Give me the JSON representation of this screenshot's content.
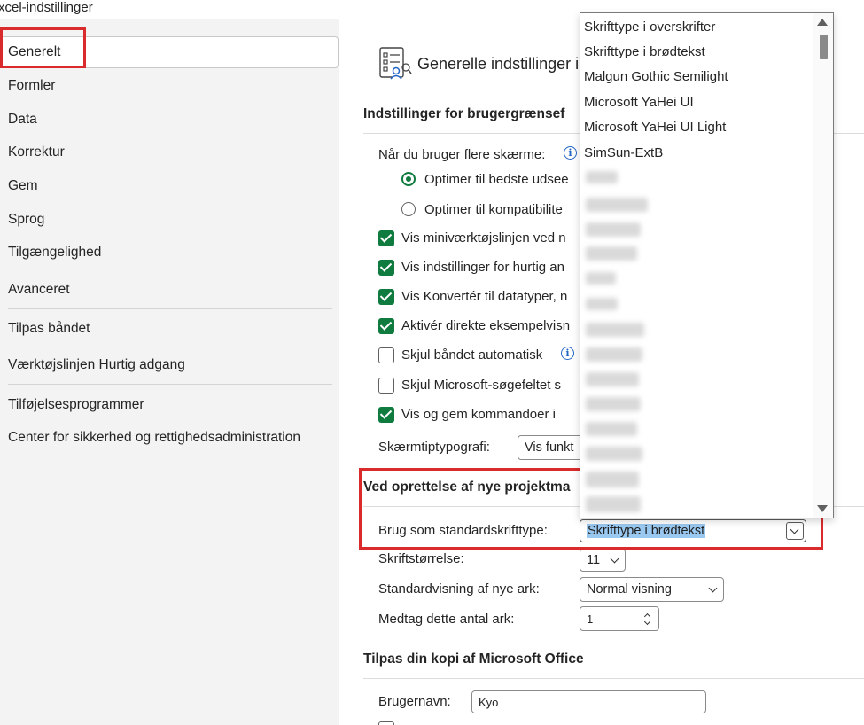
{
  "window": {
    "title": "xcel-indstillinger"
  },
  "sidebar": {
    "items": [
      {
        "label": "Generelt",
        "selected": true
      },
      {
        "label": "Formler"
      },
      {
        "label": "Data"
      },
      {
        "label": "Korrektur"
      },
      {
        "label": "Gem"
      },
      {
        "label": "Sprog"
      },
      {
        "label": "Tilgængelighed"
      },
      {
        "label": "Avanceret"
      },
      {
        "label": "Tilpas båndet"
      },
      {
        "label": "Værktøjslinjen Hurtig adgang"
      },
      {
        "label": "Tilføjelsesprogrammer"
      },
      {
        "label": "Center for sikkerhed og rettighedsadministration"
      }
    ]
  },
  "main": {
    "heading": "Generelle indstillinger i",
    "ui_section": {
      "title": "Indstillinger for brugergrænsef",
      "multi_screen_label": "Når du bruger flere skærme:",
      "radio_best": "Optimer til bedste udsee",
      "radio_compat": "Optimer til kompatibilite",
      "options": [
        {
          "label": "Vis miniværktøjslinjen ved n",
          "checked": true
        },
        {
          "label": "Vis indstillinger for hurtig an",
          "checked": true
        },
        {
          "label": "Vis Konvertér til datatyper, n",
          "checked": true
        },
        {
          "label": "Aktivér direkte eksempelvisn",
          "checked": true
        },
        {
          "label": "Skjul båndet automatisk",
          "checked": false
        },
        {
          "label": "Skjul Microsoft-søgefeltet s",
          "checked": false
        },
        {
          "label": "Vis og gem kommandoer i",
          "checked": true
        }
      ],
      "tooltip_label": "Skærmtiptypografi:",
      "tooltip_value": "Vis funkt"
    },
    "new_workbook": {
      "title": "Ved oprettelse af nye projektma",
      "font_label": "Brug som standardskrifttype:",
      "font_value": "Skrifttype i brødtekst",
      "size_label": "Skriftstørrelse:",
      "size_value": "11",
      "view_label": "Standardvisning af nye ark:",
      "view_value": "Normal visning",
      "sheets_label": "Medtag dette antal ark:",
      "sheets_value": "1"
    },
    "personalize": {
      "title": "Tilpas din kopi af Microsoft Office",
      "username_label": "Brugernavn:",
      "username_value": "Kyo"
    }
  },
  "font_dropdown": {
    "items": [
      "Skrifttype i overskrifter",
      "Skrifttype i brødtekst",
      "Malgun Gothic Semilight",
      "Microsoft YaHei UI",
      "Microsoft YaHei UI Light",
      "SimSun-ExtB"
    ]
  },
  "colors": {
    "accent": "#0f7b3f",
    "highlight_box": "#d92b2b",
    "selection": "#99c8f0",
    "info": "#2266c4"
  }
}
